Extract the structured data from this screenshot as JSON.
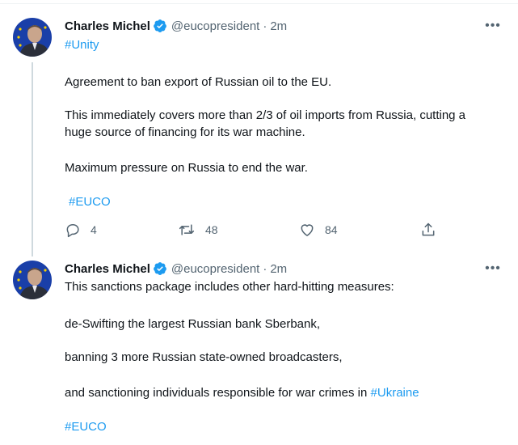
{
  "tweets": [
    {
      "author": {
        "name": "Charles Michel",
        "handle": "@eucopresident",
        "verified": true
      },
      "time": "2m",
      "lines": [
        "#Unity",
        "Agreement to ban export of Russian oil to the EU.",
        "This immediately covers more than 2/3 of oil imports from Russia, cutting a",
        "huge source of financing for its war machine.",
        "Maximum pressure on Russia to end the war.",
        "#EUCO"
      ],
      "actions": {
        "replies": "4",
        "retweets": "48",
        "likes": "84"
      }
    },
    {
      "author": {
        "name": "Charles Michel",
        "handle": "@eucopresident",
        "verified": true
      },
      "time": "2m",
      "lines": [
        "This sanctions package includes other hard-hitting measures:",
        "de-Swifting the largest Russian bank Sberbank,",
        "banning 3 more Russian state-owned broadcasters,",
        "and sanctioning individuals responsible for war crimes in ",
        "#Ukraine",
        "#EUCO"
      ]
    }
  ],
  "separator": "·",
  "more_glyph": "•••",
  "colors": {
    "accent": "#1d9bf0",
    "secondary_text": "#536471",
    "primary_text": "#0f1419",
    "thread_line": "#cfd9de",
    "avatar_bg": "#1a3fa8"
  },
  "icons": [
    "verified-badge-icon",
    "more-icon",
    "reply-icon",
    "retweet-icon",
    "like-icon",
    "share-icon"
  ]
}
